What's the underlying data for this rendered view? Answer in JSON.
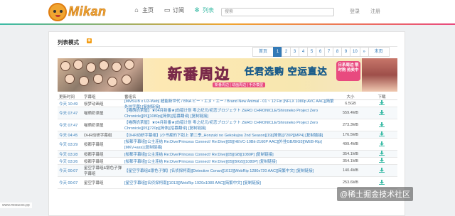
{
  "header": {
    "logo_text": "Mikan",
    "nav": {
      "home": "主页",
      "subscribe": "订阅",
      "list": "列表"
    },
    "search_placeholder": "搜索",
    "login": "登录",
    "register": "注册"
  },
  "card": {
    "title": "列表模式",
    "pager": [
      "首页",
      "1",
      "2",
      "3",
      "4",
      "5",
      "6",
      "7",
      "8",
      "9",
      "10",
      "»",
      "末页"
    ],
    "pager_active": "1"
  },
  "banner": {
    "title": "新番周边",
    "subtitle": "任君选购 空运直达",
    "badge": "日系周边 限时购 热卖中",
    "tag": "新番周边 | 动画周边 | 手办模型"
  },
  "table": {
    "headers": {
      "time": "更新时间",
      "group": "字幕组",
      "title": "番组名",
      "size": "大小",
      "download": "下载"
    },
    "rows": [
      {
        "time": "今天 10:49",
        "group": "桜梦动画组",
        "title": "[MMSUB x U3-Web] 超能新世代 / BNA ビー・エヌ・エー / Brand New Animal - 01 ~ 12 Fin [NFLX 1080p AVC AAC][简繁外挂字幕] [复制链接]",
        "size": "6.5GB"
      },
      {
        "time": "今天 07:47",
        "group": "喵萌奶茶屋",
        "title": "【喵萌奶茶屋】★04月新番★[劫猎计划 零之纪元/初恋プロジェクト ZERO CHRONICLE/Shironeko Project Zero Chronicle][05][1080p][简体][招募翻译] [复制链接]",
        "size": "559.4MB"
      },
      {
        "time": "今天 07:47",
        "group": "喵萌奶茶屋",
        "title": "【喵萌奶茶屋】★04月新番★[劫猎计划 零之纪元/初恋プロジェクト ZERO CHRONICLE/Shironeko Project Zero Chronicle][05][720p][简体][招募翻译] [复制链接]",
        "size": "273.3MB"
      },
      {
        "time": "今天 04:45",
        "group": "DHR动研字幕组",
        "title": "【DHR动研字幕组】[小书痴的下剋上 第二季_Honzuki no Gekokujou 2nd Season][19][简体][720P][MP4] [复制链接]",
        "size": "176.5MB"
      },
      {
        "time": "今天 03:29",
        "group": "桜都字幕组",
        "title": "[桜都字幕组][公主连结 Re:Dive/Princess Connect! Re:Dive][05][HEVC-10Bit-2160P AAC][外挂GB/BIG5][WEB-Rip][MKV+ass] [复制链接]",
        "size": "499.4MB"
      },
      {
        "time": "今天 03:28",
        "group": "桜都字幕组",
        "title": "[桜都字幕组][公主连结 Re:Dive/Princess Connect! Re:Dive][05][GB][1080P] [复制链接]",
        "size": "354.1MB"
      },
      {
        "time": "今天 03:26",
        "group": "桜都字幕组",
        "title": "[桜都字幕组][公主连结 Re:Dive/Princess Connect! Re:Dive][05][BIG5][1080P] [复制链接]",
        "size": "354.1MB"
      },
      {
        "time": "今天 00:07",
        "group": "星空字幕组&银色子弹字幕组",
        "title": "【星空字幕组&银色子弹】[名侦探柯南][Detective Conan][1013][WebRip 1280x720 AAC][简繁中文] [复制链接]",
        "size": "140.4MB"
      },
      {
        "time": "今天 00:07",
        "group": "星空字幕组",
        "title": "[星空字幕组][名侦探柯南][1013][WebRip 1920x1080 AAC][简繁中文] [复制链接]",
        "size": "253.6MB"
      }
    ]
  },
  "overlay": {
    "watermark": "@稀土掘金技术社区",
    "footer_url": "www.mosucxs.pp"
  }
}
